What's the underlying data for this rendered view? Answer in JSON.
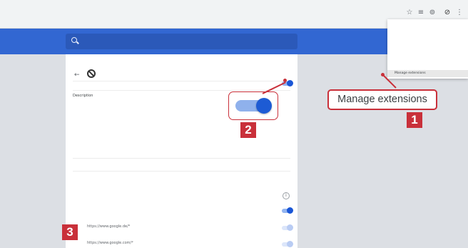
{
  "browser": {
    "url": "",
    "toolbar_icons": [
      "star-icon",
      "extension-icon",
      "account-icon",
      "ublock-toolbar-icon",
      "more-menu-icon"
    ]
  },
  "search": {
    "placeholder": ""
  },
  "extension": {
    "name": "",
    "on_label": "",
    "description_heading": "Description",
    "description_text": "",
    "version_heading": "",
    "version_value": "",
    "size_heading": "",
    "size_value": "",
    "permissions_heading": "",
    "site_access_heading": "",
    "site_access_text": "",
    "auto_allow_label": "",
    "sites": [
      "https://www.google.de/*",
      "https://www.google.com/*"
    ]
  },
  "context_menu": {
    "items": [
      "",
      "",
      "",
      "",
      "",
      "Manage extensions"
    ],
    "highlighted_index": 5
  },
  "callouts": {
    "manage_label": "Manage extensions",
    "badge_1": "1",
    "badge_2": "2",
    "badge_3": "3"
  },
  "colors": {
    "accent_blue": "#3267d2",
    "callout_red": "#c9303a"
  }
}
